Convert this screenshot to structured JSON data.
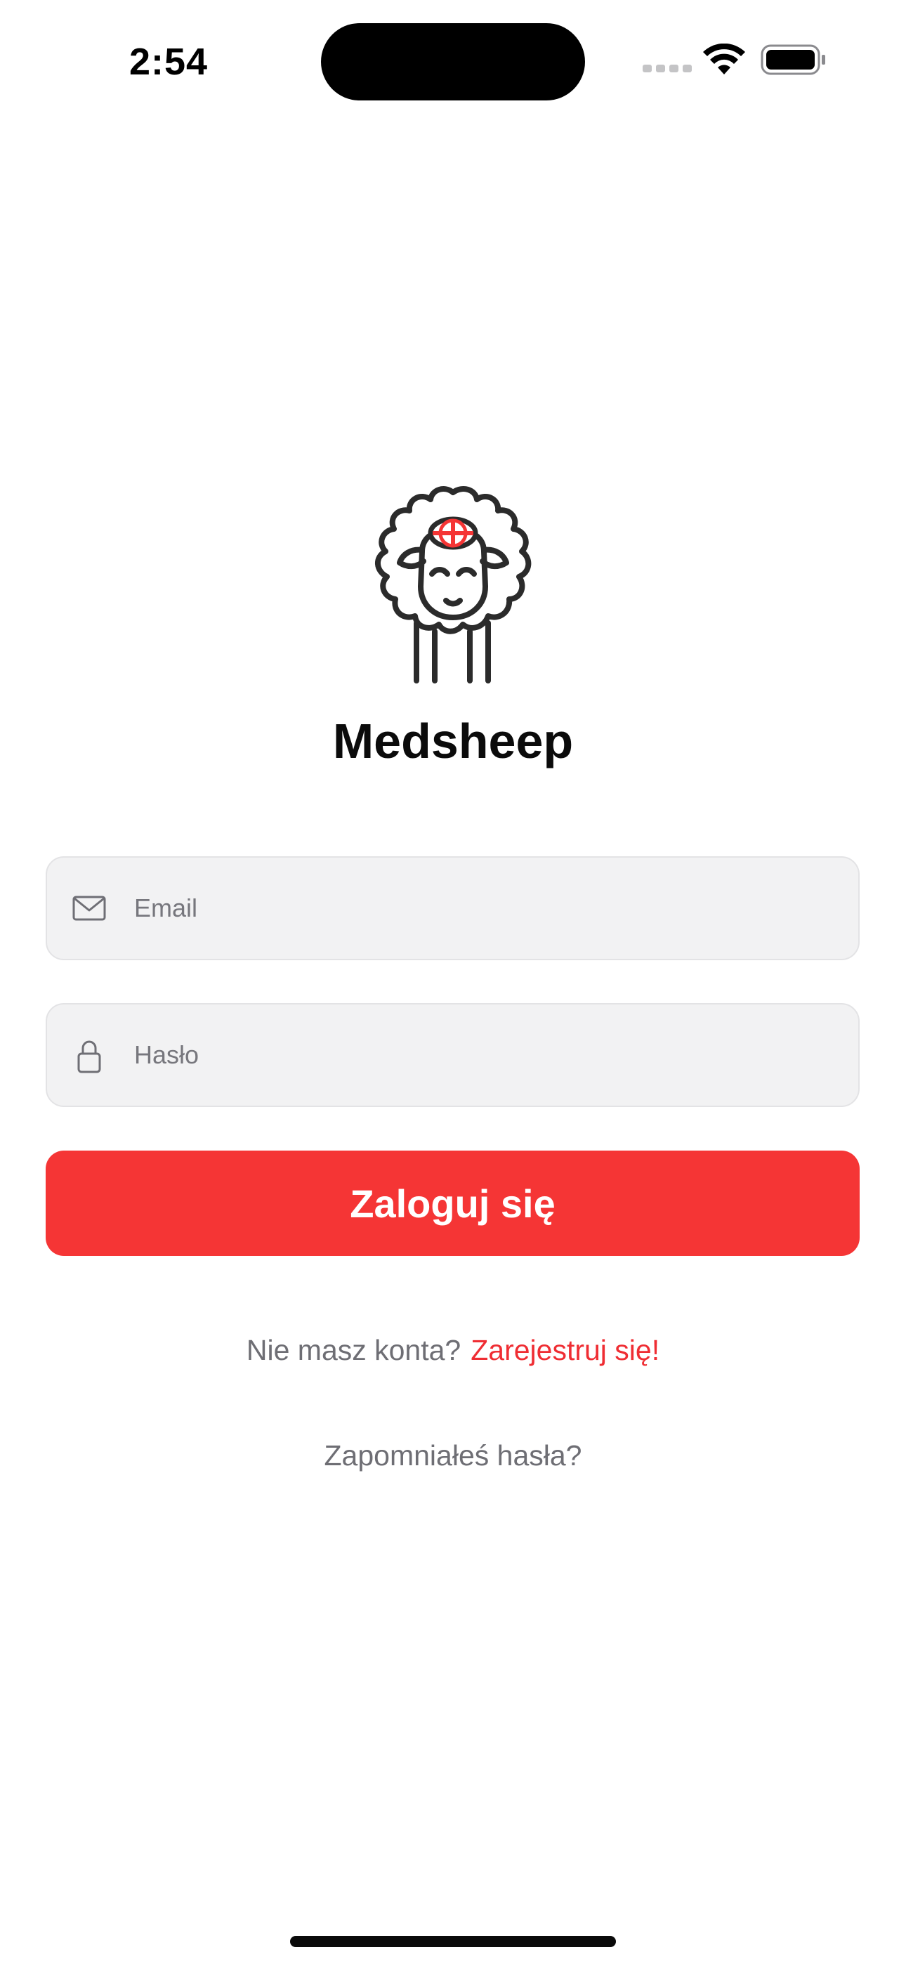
{
  "status_bar": {
    "time": "2:54",
    "icons": [
      "cellular-signal-icon",
      "wifi-icon",
      "battery-icon"
    ]
  },
  "logo": {
    "icon": "sheep-with-medical-cross-icon",
    "accent_color": "#f53535",
    "line_color": "#2b2b2b"
  },
  "app": {
    "title": "Medsheep"
  },
  "form": {
    "email": {
      "icon": "envelope-icon",
      "placeholder": "Email",
      "value": ""
    },
    "password": {
      "icon": "lock-icon",
      "placeholder": "Hasło",
      "value": ""
    },
    "login_label": "Zaloguj się",
    "login_color": "#f53535"
  },
  "footer": {
    "register_prompt": "Nie masz konta?",
    "register_link": "Zarejestruj się!",
    "forgot_password": "Zapomniałeś hasła?"
  }
}
